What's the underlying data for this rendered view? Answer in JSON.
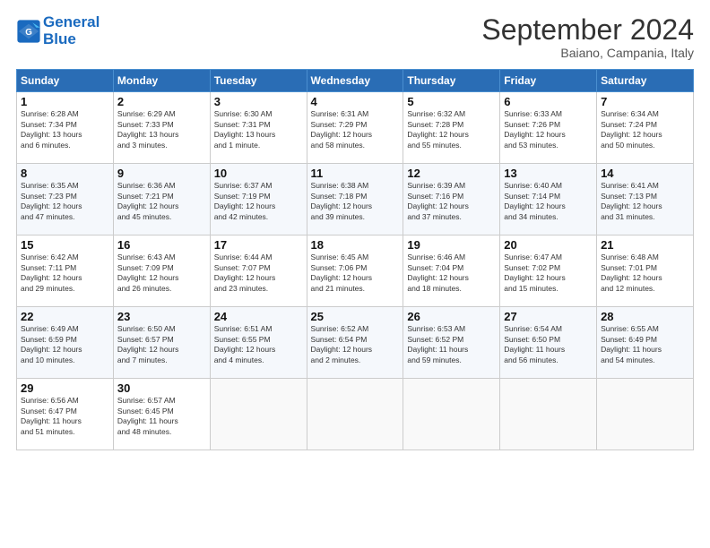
{
  "header": {
    "logo_line1": "General",
    "logo_line2": "Blue",
    "month_title": "September 2024",
    "subtitle": "Baiano, Campania, Italy"
  },
  "weekdays": [
    "Sunday",
    "Monday",
    "Tuesday",
    "Wednesday",
    "Thursday",
    "Friday",
    "Saturday"
  ],
  "weeks": [
    [
      {
        "day": "1",
        "lines": [
          "Sunrise: 6:28 AM",
          "Sunset: 7:34 PM",
          "Daylight: 13 hours",
          "and 6 minutes."
        ]
      },
      {
        "day": "2",
        "lines": [
          "Sunrise: 6:29 AM",
          "Sunset: 7:33 PM",
          "Daylight: 13 hours",
          "and 3 minutes."
        ]
      },
      {
        "day": "3",
        "lines": [
          "Sunrise: 6:30 AM",
          "Sunset: 7:31 PM",
          "Daylight: 13 hours",
          "and 1 minute."
        ]
      },
      {
        "day": "4",
        "lines": [
          "Sunrise: 6:31 AM",
          "Sunset: 7:29 PM",
          "Daylight: 12 hours",
          "and 58 minutes."
        ]
      },
      {
        "day": "5",
        "lines": [
          "Sunrise: 6:32 AM",
          "Sunset: 7:28 PM",
          "Daylight: 12 hours",
          "and 55 minutes."
        ]
      },
      {
        "day": "6",
        "lines": [
          "Sunrise: 6:33 AM",
          "Sunset: 7:26 PM",
          "Daylight: 12 hours",
          "and 53 minutes."
        ]
      },
      {
        "day": "7",
        "lines": [
          "Sunrise: 6:34 AM",
          "Sunset: 7:24 PM",
          "Daylight: 12 hours",
          "and 50 minutes."
        ]
      }
    ],
    [
      {
        "day": "8",
        "lines": [
          "Sunrise: 6:35 AM",
          "Sunset: 7:23 PM",
          "Daylight: 12 hours",
          "and 47 minutes."
        ]
      },
      {
        "day": "9",
        "lines": [
          "Sunrise: 6:36 AM",
          "Sunset: 7:21 PM",
          "Daylight: 12 hours",
          "and 45 minutes."
        ]
      },
      {
        "day": "10",
        "lines": [
          "Sunrise: 6:37 AM",
          "Sunset: 7:19 PM",
          "Daylight: 12 hours",
          "and 42 minutes."
        ]
      },
      {
        "day": "11",
        "lines": [
          "Sunrise: 6:38 AM",
          "Sunset: 7:18 PM",
          "Daylight: 12 hours",
          "and 39 minutes."
        ]
      },
      {
        "day": "12",
        "lines": [
          "Sunrise: 6:39 AM",
          "Sunset: 7:16 PM",
          "Daylight: 12 hours",
          "and 37 minutes."
        ]
      },
      {
        "day": "13",
        "lines": [
          "Sunrise: 6:40 AM",
          "Sunset: 7:14 PM",
          "Daylight: 12 hours",
          "and 34 minutes."
        ]
      },
      {
        "day": "14",
        "lines": [
          "Sunrise: 6:41 AM",
          "Sunset: 7:13 PM",
          "Daylight: 12 hours",
          "and 31 minutes."
        ]
      }
    ],
    [
      {
        "day": "15",
        "lines": [
          "Sunrise: 6:42 AM",
          "Sunset: 7:11 PM",
          "Daylight: 12 hours",
          "and 29 minutes."
        ]
      },
      {
        "day": "16",
        "lines": [
          "Sunrise: 6:43 AM",
          "Sunset: 7:09 PM",
          "Daylight: 12 hours",
          "and 26 minutes."
        ]
      },
      {
        "day": "17",
        "lines": [
          "Sunrise: 6:44 AM",
          "Sunset: 7:07 PM",
          "Daylight: 12 hours",
          "and 23 minutes."
        ]
      },
      {
        "day": "18",
        "lines": [
          "Sunrise: 6:45 AM",
          "Sunset: 7:06 PM",
          "Daylight: 12 hours",
          "and 21 minutes."
        ]
      },
      {
        "day": "19",
        "lines": [
          "Sunrise: 6:46 AM",
          "Sunset: 7:04 PM",
          "Daylight: 12 hours",
          "and 18 minutes."
        ]
      },
      {
        "day": "20",
        "lines": [
          "Sunrise: 6:47 AM",
          "Sunset: 7:02 PM",
          "Daylight: 12 hours",
          "and 15 minutes."
        ]
      },
      {
        "day": "21",
        "lines": [
          "Sunrise: 6:48 AM",
          "Sunset: 7:01 PM",
          "Daylight: 12 hours",
          "and 12 minutes."
        ]
      }
    ],
    [
      {
        "day": "22",
        "lines": [
          "Sunrise: 6:49 AM",
          "Sunset: 6:59 PM",
          "Daylight: 12 hours",
          "and 10 minutes."
        ]
      },
      {
        "day": "23",
        "lines": [
          "Sunrise: 6:50 AM",
          "Sunset: 6:57 PM",
          "Daylight: 12 hours",
          "and 7 minutes."
        ]
      },
      {
        "day": "24",
        "lines": [
          "Sunrise: 6:51 AM",
          "Sunset: 6:55 PM",
          "Daylight: 12 hours",
          "and 4 minutes."
        ]
      },
      {
        "day": "25",
        "lines": [
          "Sunrise: 6:52 AM",
          "Sunset: 6:54 PM",
          "Daylight: 12 hours",
          "and 2 minutes."
        ]
      },
      {
        "day": "26",
        "lines": [
          "Sunrise: 6:53 AM",
          "Sunset: 6:52 PM",
          "Daylight: 11 hours",
          "and 59 minutes."
        ]
      },
      {
        "day": "27",
        "lines": [
          "Sunrise: 6:54 AM",
          "Sunset: 6:50 PM",
          "Daylight: 11 hours",
          "and 56 minutes."
        ]
      },
      {
        "day": "28",
        "lines": [
          "Sunrise: 6:55 AM",
          "Sunset: 6:49 PM",
          "Daylight: 11 hours",
          "and 54 minutes."
        ]
      }
    ],
    [
      {
        "day": "29",
        "lines": [
          "Sunrise: 6:56 AM",
          "Sunset: 6:47 PM",
          "Daylight: 11 hours",
          "and 51 minutes."
        ]
      },
      {
        "day": "30",
        "lines": [
          "Sunrise: 6:57 AM",
          "Sunset: 6:45 PM",
          "Daylight: 11 hours",
          "and 48 minutes."
        ]
      },
      null,
      null,
      null,
      null,
      null
    ]
  ]
}
